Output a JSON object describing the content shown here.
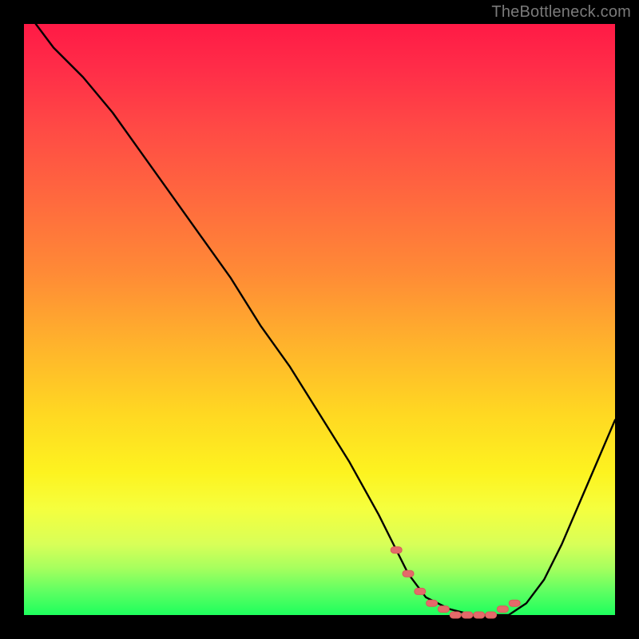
{
  "watermark": "TheBottleneck.com",
  "colors": {
    "page_bg": "#000000",
    "curve": "#000000",
    "marker_fill": "#e46a6a",
    "marker_stroke": "#d85a5a",
    "watermark": "#7a7a7a",
    "gradient_top": "#ff1a46",
    "gradient_bottom": "#1eff5d"
  },
  "chart_data": {
    "type": "line",
    "title": "",
    "xlabel": "",
    "ylabel": "",
    "xlim": [
      0,
      100
    ],
    "ylim": [
      0,
      100
    ],
    "grid": false,
    "legend": false,
    "series": [
      {
        "name": "bottleneck-curve",
        "x": [
          2,
          5,
          10,
          15,
          20,
          25,
          30,
          35,
          40,
          45,
          50,
          55,
          60,
          63,
          65,
          68,
          72,
          76,
          80,
          82,
          85,
          88,
          91,
          94,
          97,
          100
        ],
        "y": [
          100,
          96,
          91,
          85,
          78,
          71,
          64,
          57,
          49,
          42,
          34,
          26,
          17,
          11,
          7,
          3,
          1,
          0,
          0,
          0,
          2,
          6,
          12,
          19,
          26,
          33
        ]
      }
    ],
    "markers": {
      "name": "valley-markers",
      "x": [
        63,
        65,
        67,
        69,
        71,
        73,
        75,
        77,
        79,
        81,
        83
      ],
      "y": [
        11,
        7,
        4,
        2,
        1,
        0,
        0,
        0,
        0,
        1,
        2
      ]
    }
  }
}
